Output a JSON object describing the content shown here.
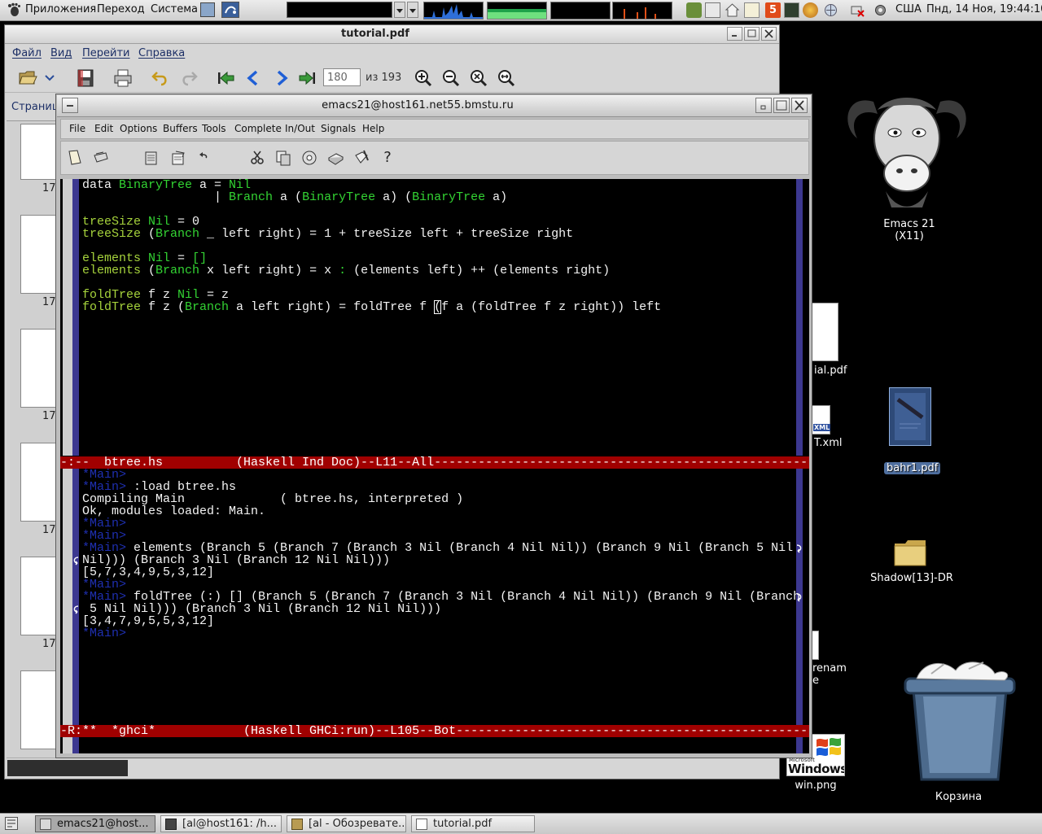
{
  "panel": {
    "menus": [
      "Приложения",
      "Переход",
      "Система"
    ],
    "tray_badge": "5",
    "keyboard_layout": "США",
    "clock": "Пнд, 14 Ноя, 19:44:10"
  },
  "evince": {
    "title": "tutorial.pdf",
    "menu": [
      "Файл",
      "Вид",
      "Перейти",
      "Справка"
    ],
    "page_current": "180",
    "page_total_label": "из 193",
    "sidebar_label": "Страниц",
    "thumb_labels": [
      "17",
      "17",
      "17",
      "17",
      "17"
    ]
  },
  "emacs": {
    "title": "emacs21@host161.net55.bmstu.ru",
    "menu": [
      "File",
      "Edit",
      "Options",
      "Buffers",
      "Tools",
      "Complete",
      "In/Out",
      "Signals",
      "Help"
    ],
    "toolbar_help_glyph": "?",
    "colors": {
      "mode_line": "#a00000",
      "constructor": "#33d433",
      "function": "#a6d33c",
      "prompt": "#1e2fb0",
      "fringe": "#3c3890"
    },
    "source_buffer": {
      "lines": [
        [
          [
            "data ",
            ""
          ],
          [
            "BinaryTree",
            "con"
          ],
          [
            " a = ",
            ""
          ],
          [
            "Nil",
            "con"
          ]
        ],
        [
          [
            "                  | ",
            ""
          ],
          [
            "Branch",
            "con"
          ],
          [
            " a (",
            ""
          ],
          [
            "BinaryTree",
            "con"
          ],
          [
            " a) (",
            ""
          ],
          [
            "BinaryTree",
            "con"
          ],
          [
            " a)",
            ""
          ]
        ],
        [],
        [
          [
            "treeSize",
            "fn"
          ],
          [
            " ",
            ""
          ],
          [
            "Nil",
            "con"
          ],
          [
            " = 0",
            ""
          ]
        ],
        [
          [
            "treeSize",
            "fn"
          ],
          [
            " (",
            ""
          ],
          [
            "Branch",
            "con"
          ],
          [
            " _ left right) = 1 + treeSize left + treeSize right",
            ""
          ]
        ],
        [],
        [
          [
            "elements",
            "fn"
          ],
          [
            " ",
            ""
          ],
          [
            "Nil",
            "con"
          ],
          [
            " = ",
            ""
          ],
          [
            "[]",
            "con"
          ]
        ],
        [
          [
            "elements",
            "fn"
          ],
          [
            " (",
            ""
          ],
          [
            "Branch",
            "con"
          ],
          [
            " x left right) = x ",
            ""
          ],
          [
            ":",
            "con"
          ],
          [
            " (elements left) ++ (elements right)",
            ""
          ]
        ],
        [],
        [
          [
            "foldTree",
            "fn"
          ],
          [
            " f z ",
            ""
          ],
          [
            "Nil",
            "con"
          ],
          [
            " = z",
            ""
          ]
        ],
        [
          [
            "foldTree",
            "fn"
          ],
          [
            " f z (",
            ""
          ],
          [
            "Branch",
            "con"
          ],
          [
            " a left right) = foldTree f ",
            ""
          ],
          [
            "(",
            "cursor"
          ],
          [
            "f a (foldTree f z right)) left",
            ""
          ]
        ]
      ],
      "mode_line": "-:--  btree.hs          (Haskell Ind Doc)--L11--All----------------------------------------------------------------------"
    },
    "ghci_buffer": {
      "lines": [
        {
          "seg": [
            [
              "*Main>",
              "prompt"
            ]
          ]
        },
        {
          "seg": [
            [
              "*Main>",
              "prompt"
            ],
            [
              " :load btree.hs",
              ""
            ]
          ]
        },
        {
          "seg": [
            [
              "Compiling Main             ( btree.hs, interpreted )",
              ""
            ]
          ]
        },
        {
          "seg": [
            [
              "Ok, modules loaded: Main.",
              ""
            ]
          ]
        },
        {
          "seg": [
            [
              "*Main>",
              "prompt"
            ]
          ]
        },
        {
          "seg": [
            [
              "*Main>",
              "prompt"
            ]
          ]
        },
        {
          "seg": [
            [
              "*Main>",
              "prompt"
            ],
            [
              " elements (Branch 5 (Branch 7 (Branch 3 Nil (Branch 4 Nil Nil)) (Branch 9 Nil (Branch 5 Nil ",
              ""
            ]
          ],
          "wrap_right": true
        },
        {
          "seg": [
            [
              "Nil))) (Branch 3 Nil (Branch 12 Nil Nil)))",
              ""
            ]
          ],
          "wrap_left": true
        },
        {
          "seg": [
            [
              "[5,7,3,4,9,5,3,12]",
              ""
            ]
          ]
        },
        {
          "seg": [
            [
              "*Main>",
              "prompt"
            ]
          ]
        },
        {
          "seg": [
            [
              "*Main>",
              "prompt"
            ],
            [
              " foldTree (:) [] (Branch 5 (Branch 7 (Branch 3 Nil (Branch 4 Nil Nil)) (Branch 9 Nil (Branch",
              ""
            ]
          ],
          "wrap_right": true
        },
        {
          "seg": [
            [
              " 5 Nil Nil))) (Branch 3 Nil (Branch 12 Nil Nil)))",
              ""
            ]
          ],
          "wrap_left": true
        },
        {
          "seg": [
            [
              "[3,4,7,9,5,5,3,12]",
              ""
            ]
          ]
        },
        {
          "seg": [
            [
              "*Main>",
              "prompt"
            ]
          ]
        }
      ],
      "mode_line": "-R:**  *ghci*            (Haskell GHCi:run)--L105--Bot----------------------------------------------------------------------"
    }
  },
  "desktop": {
    "emacs_label": "Emacs 21\n(X11)",
    "tutorial_label": "ial.pdf",
    "xml_label": "T.xml",
    "xml_badge": "XML",
    "bahr_label": "bahr1.pdf",
    "folder_label": "Shadow[13]-DR",
    "rename_label": "renam\ne",
    "win_logo_small": "Microsoft",
    "win_logo_big": "Windows",
    "win_label": "win.png",
    "trash_label": "Корзина"
  },
  "taskbar": {
    "items": [
      "emacs21@host...",
      "[al@host161: /h...",
      "[al - Обозревате...",
      "tutorial.pdf"
    ]
  }
}
